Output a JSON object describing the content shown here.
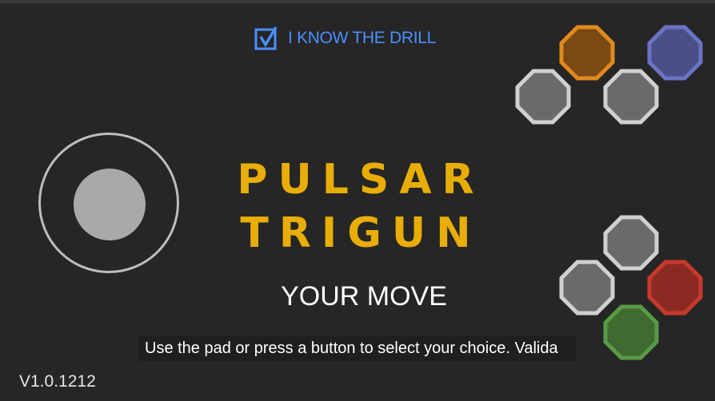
{
  "drill_toggle": {
    "label": "I KNOW THE DRILL",
    "checked": true,
    "color": "#4a90ff"
  },
  "game": {
    "title_line1": "PULSAR",
    "title_line2": "TRIGUN",
    "title_color": "#e8ad06"
  },
  "prompt": {
    "heading": "YOUR MOVE",
    "instruction": "Use the pad or press a button to select your choice. Valida"
  },
  "version": "V1.0.1212",
  "controls": {
    "joystick": {
      "icon": "joystick-icon"
    },
    "top_cluster": [
      {
        "name": "orange-button",
        "color": "#b86e16",
        "border": "#e08a1d"
      },
      {
        "name": "blue-button",
        "color": "#4a4f86",
        "border": "#6a73c4"
      },
      {
        "name": "gray-left-button",
        "color": "#6a6a6a",
        "border": "#d0d0d0"
      },
      {
        "name": "gray-right-button",
        "color": "#6a6a6a",
        "border": "#d0d0d0"
      }
    ],
    "bottom_cluster": [
      {
        "name": "gray-top-button",
        "color": "#6a6a6a",
        "border": "#d0d0d0"
      },
      {
        "name": "gray-left-button",
        "color": "#6a6a6a",
        "border": "#d0d0d0"
      },
      {
        "name": "red-button",
        "color": "#8b2a22",
        "border": "#c63a2c"
      },
      {
        "name": "green-button",
        "color": "#3f6b30",
        "border": "#5a9a45"
      }
    ]
  }
}
